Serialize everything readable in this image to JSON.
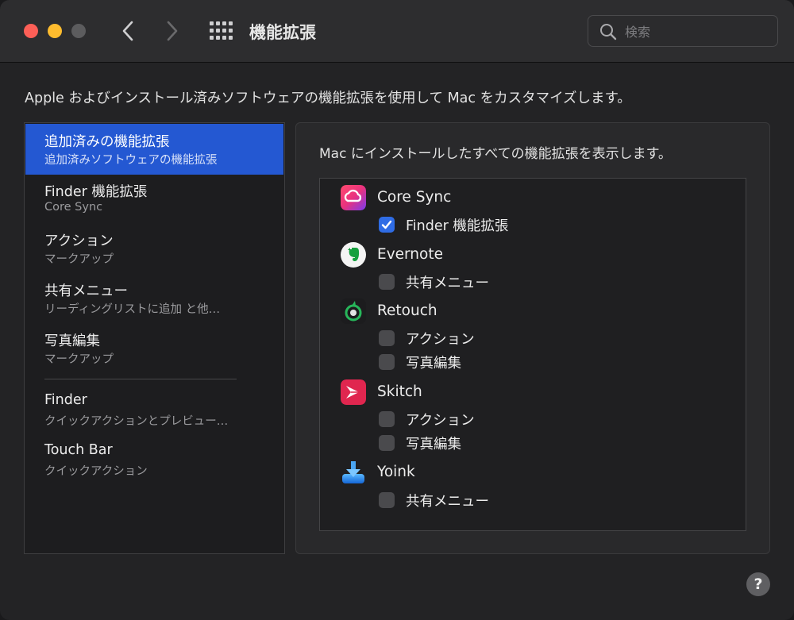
{
  "window": {
    "title": "機能拡張",
    "search_placeholder": "検索"
  },
  "description": "Apple およびインストール済みソフトウェアの機能拡張を使用して Mac をカスタマイズします。",
  "sidebar": {
    "items": [
      {
        "title": "追加済みの機能拡張",
        "subtitle": "追加済みソフトウェアの機能拡張",
        "selected": true
      },
      {
        "title": "Finder 機能拡張",
        "subtitle": "Core Sync",
        "selected": false
      },
      {
        "title": "アクション",
        "subtitle": "マークアップ",
        "selected": false
      },
      {
        "title": "共有メニュー",
        "subtitle": "リーディングリストに追加 と他…",
        "selected": false
      },
      {
        "title": "写真編集",
        "subtitle": "マークアップ",
        "selected": false
      },
      {
        "title": "Finder",
        "subtitle": "クイックアクションとプレビュー…",
        "selected": false
      },
      {
        "title": "Touch Bar",
        "subtitle": "クイックアクション",
        "selected": false
      }
    ]
  },
  "panel": {
    "description": "Mac にインストールしたすべての機能拡張を表示します。",
    "apps": [
      {
        "name": "Core Sync",
        "icon": "creative-cloud-icon",
        "extensions": [
          {
            "label": "Finder 機能拡張",
            "checked": true
          }
        ]
      },
      {
        "name": "Evernote",
        "icon": "evernote-icon",
        "extensions": [
          {
            "label": "共有メニュー",
            "checked": false
          }
        ]
      },
      {
        "name": "Retouch",
        "icon": "retouch-icon",
        "extensions": [
          {
            "label": "アクション",
            "checked": false
          },
          {
            "label": "写真編集",
            "checked": false
          }
        ]
      },
      {
        "name": "Skitch",
        "icon": "skitch-icon",
        "extensions": [
          {
            "label": "アクション",
            "checked": false
          },
          {
            "label": "写真編集",
            "checked": false
          }
        ]
      },
      {
        "name": "Yoink",
        "icon": "yoink-icon",
        "extensions": [
          {
            "label": "共有メニュー",
            "checked": false
          }
        ]
      }
    ]
  },
  "help_label": "?",
  "colors": {
    "accent": "#2458d2",
    "checkbox_checked": "#2f6ce5"
  }
}
